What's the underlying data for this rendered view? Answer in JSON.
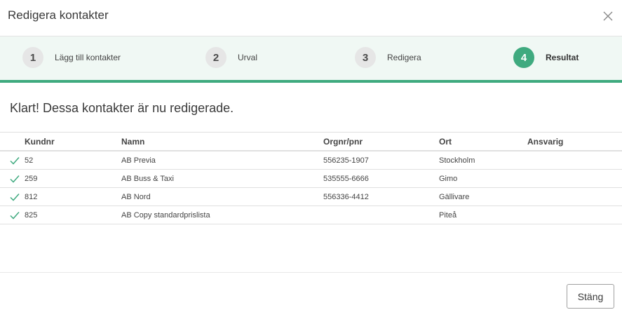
{
  "dialog": {
    "title": "Redigera kontakter"
  },
  "stepper": {
    "steps": [
      {
        "number": "1",
        "label": "Lägg till kontakter"
      },
      {
        "number": "2",
        "label": "Urval"
      },
      {
        "number": "3",
        "label": "Redigera"
      },
      {
        "number": "4",
        "label": "Resultat",
        "active": true
      }
    ]
  },
  "main": {
    "heading": "Klart! Dessa kontakter är nu redigerade.",
    "table": {
      "columns": [
        "Kundnr",
        "Namn",
        "Orgnr/pnr",
        "Ort",
        "Ansvarig"
      ],
      "rows": [
        {
          "kundnr": "52",
          "namn": "AB Previa",
          "orgnr": "556235-1907",
          "ort": "Stockholm",
          "ansvarig": ""
        },
        {
          "kundnr": "259",
          "namn": "AB Buss & Taxi",
          "orgnr": "535555-6666",
          "ort": "Gimo",
          "ansvarig": ""
        },
        {
          "kundnr": "812",
          "namn": "AB Nord",
          "orgnr": "556336-4412",
          "ort": "Gällivare",
          "ansvarig": ""
        },
        {
          "kundnr": "825",
          "namn": "AB Copy standardprislista",
          "orgnr": "",
          "ort": "Piteå",
          "ansvarig": ""
        }
      ]
    }
  },
  "footer": {
    "close_label": "Stäng"
  },
  "icons": {
    "close": "close-icon",
    "check": "check-icon"
  },
  "colors": {
    "accent": "#3faa7f",
    "stepper_bg": "#f0f8f4"
  }
}
